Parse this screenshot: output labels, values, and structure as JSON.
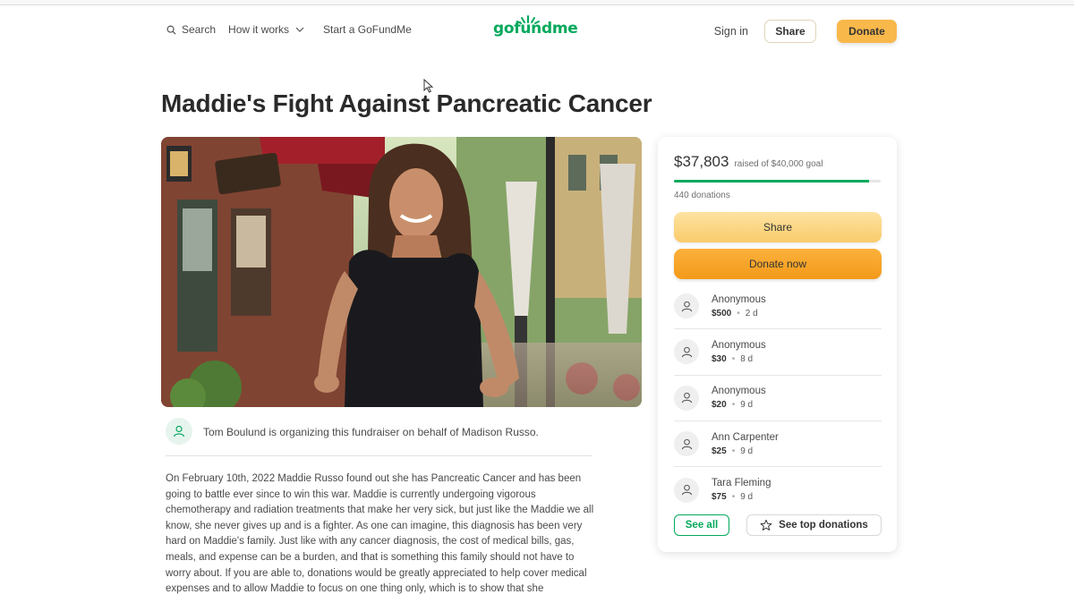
{
  "nav": {
    "search_label": "Search",
    "how_it_works_label": "How it works",
    "start_label": "Start a GoFundMe",
    "logo_text": "gofundme",
    "signin_label": "Sign in",
    "share_label": "Share",
    "donate_label": "Donate"
  },
  "campaign": {
    "title": "Maddie's Fight Against Pancreatic Cancer",
    "organizer_text": "Tom Boulund is organizing this fundraiser on behalf of Madison Russo.",
    "story": "On February 10th, 2022 Maddie Russo found out she has Pancreatic Cancer and has been going to battle ever since to win this war. Maddie is currently undergoing vigorous chemotherapy and radiation treatments that make her very sick, but just like the Maddie we all know, she never gives up and is a fighter. As one can imagine, this diagnosis has been very hard on Maddie's family. Just like with any cancer diagnosis, the cost of medical bills, gas, meals, and expense can be a burden, and that is something this family should not have to worry about. If you are able to, donations would be greatly appreciated to help cover medical expenses and to allow Maddie to focus on one thing only, which is to show that she"
  },
  "sidebar": {
    "raised_amount": "$37,803",
    "goal_text": "raised of $40,000 goal",
    "progress_fraction": 0.945,
    "donation_count": "440 donations",
    "share_label": "Share",
    "donate_now_label": "Donate now",
    "donors": [
      {
        "name": "Anonymous",
        "amount": "$500",
        "time": "2 d"
      },
      {
        "name": "Anonymous",
        "amount": "$30",
        "time": "8 d"
      },
      {
        "name": "Anonymous",
        "amount": "$20",
        "time": "9 d"
      },
      {
        "name": "Ann Carpenter",
        "amount": "$25",
        "time": "9 d"
      },
      {
        "name": "Tara Fleming",
        "amount": "$75",
        "time": "9 d"
      }
    ],
    "see_all_label": "See all",
    "top_donations_label": "See top donations"
  },
  "colors": {
    "brand_green": "#02a95c",
    "donate_orange": "#f9b84a",
    "share_yellow": "#fde3a2"
  },
  "icons": {
    "search": "search-icon",
    "chevron": "chevron-down-icon",
    "person": "person-icon",
    "star": "star-icon"
  }
}
